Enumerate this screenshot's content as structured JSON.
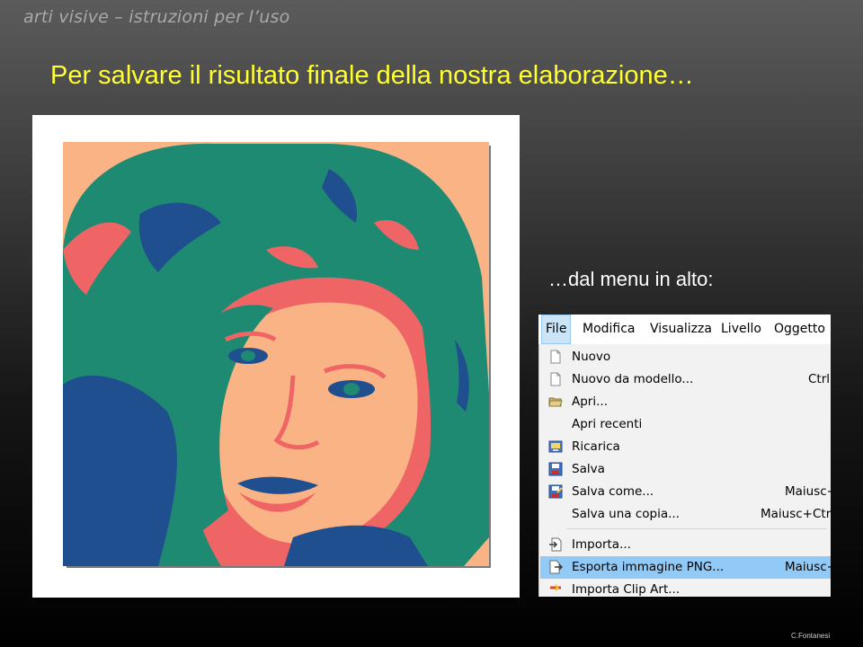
{
  "header": {
    "title": "arti visive – istruzioni per l’uso"
  },
  "slide": {
    "title": "Per salvare il risultato finale della nostra elaborazione…",
    "subtitle": "…dal menu in alto:",
    "credit": "C.Fontanesi"
  },
  "photo": {
    "palette": {
      "skin": "#f9b384",
      "hair": "#1f8a72",
      "outline": "#ef6566",
      "shadow": "#1f4f8f"
    }
  },
  "menubar": {
    "items": [
      {
        "label": "File",
        "active": true
      },
      {
        "label": "Modifica"
      },
      {
        "label": "Visualizza"
      },
      {
        "label": "Livello"
      },
      {
        "label": "Oggetto"
      }
    ]
  },
  "file_menu": {
    "items": [
      {
        "label": "Nuovo",
        "icon": "new-document-icon",
        "shortcut": ""
      },
      {
        "label": "Nuovo da modello...",
        "icon": "template-document-icon",
        "shortcut": "Ctrl+"
      },
      {
        "label": "Apri...",
        "icon": "folder-open-icon",
        "shortcut": ""
      },
      {
        "label": "Apri recenti",
        "icon": "",
        "shortcut": ""
      },
      {
        "label": "Ricarica",
        "icon": "reload-icon",
        "shortcut": ""
      },
      {
        "label": "Salva",
        "icon": "save-icon",
        "shortcut": ""
      },
      {
        "label": "Salva come...",
        "icon": "save-as-icon",
        "shortcut": "Maiusc+"
      },
      {
        "label": "Salva una copia...",
        "icon": "",
        "shortcut": "Maiusc+Ctrl"
      },
      {
        "label": "Importa...",
        "icon": "import-icon",
        "shortcut": ""
      },
      {
        "label": "Esporta immagine PNG...",
        "icon": "export-icon",
        "shortcut": "Maiusc+",
        "highlighted": true
      },
      {
        "label": "Importa Clip Art...",
        "icon": "clipart-icon",
        "shortcut": ""
      }
    ]
  }
}
